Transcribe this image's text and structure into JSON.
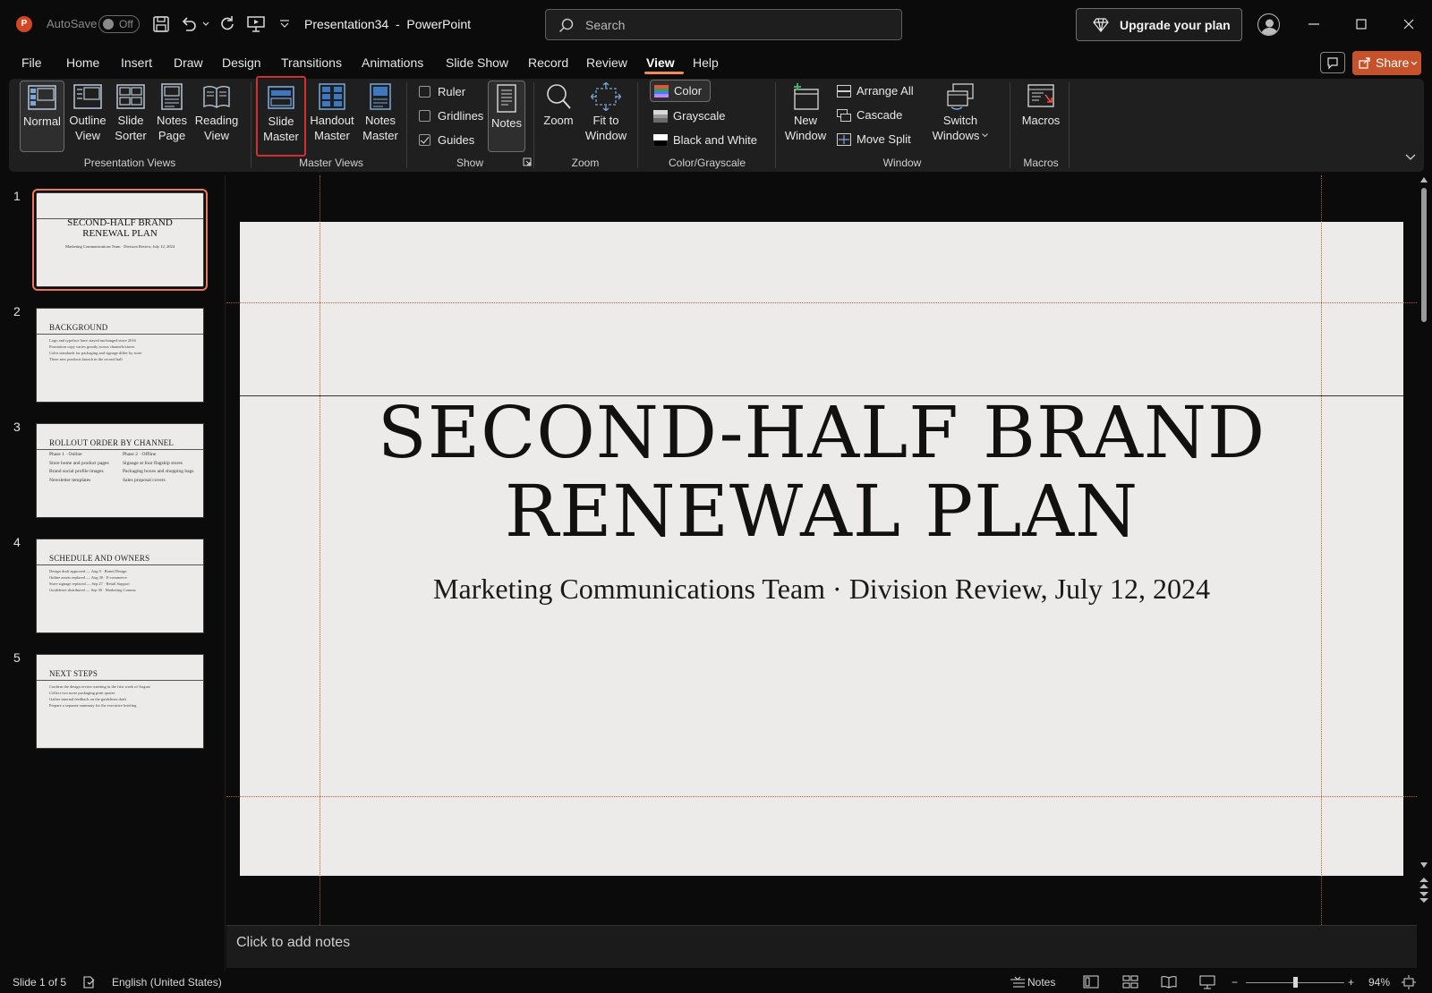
{
  "titlebar": {
    "app_logo": "P",
    "autosave_label": "AutoSave",
    "autosave_state": "Off",
    "doc_title": "Presentation34  -  PowerPoint",
    "search_placeholder": "Search",
    "upgrade_label": "Upgrade your plan"
  },
  "menu": {
    "items": [
      "File",
      "Home",
      "Insert",
      "Draw",
      "Design",
      "Transitions",
      "Animations",
      "Slide Show",
      "Record",
      "Review",
      "View",
      "Help"
    ],
    "active": "View",
    "share_label": "Share"
  },
  "ribbon": {
    "presentation_views": {
      "label": "Presentation Views",
      "normal": "Normal",
      "outline_1": "Outline",
      "outline_2": "View",
      "sorter_1": "Slide",
      "sorter_2": "Sorter",
      "notes_page_1": "Notes",
      "notes_page_2": "Page",
      "reading_1": "Reading",
      "reading_2": "View"
    },
    "master_views": {
      "label": "Master Views",
      "slide_master_1": "Slide",
      "slide_master_2": "Master",
      "handout_master_1": "Handout",
      "handout_master_2": "Master",
      "notes_master_1": "Notes",
      "notes_master_2": "Master"
    },
    "show": {
      "label": "Show",
      "ruler": "Ruler",
      "gridlines": "Gridlines",
      "guides": "Guides",
      "notes": "Notes"
    },
    "zoom": {
      "label": "Zoom",
      "zoom": "Zoom",
      "fit_1": "Fit to",
      "fit_2": "Window"
    },
    "color_grayscale": {
      "label": "Color/Grayscale",
      "color": "Color",
      "grayscale": "Grayscale",
      "bw": "Black and White"
    },
    "window": {
      "label": "Window",
      "new_1": "New",
      "new_2": "Window",
      "arrange_all": "Arrange All",
      "cascade": "Cascade",
      "move_split": "Move Split",
      "switch_1": "Switch",
      "switch_2": "Windows"
    },
    "macros": {
      "label": "Macros",
      "macros": "Macros"
    }
  },
  "thumbnails": [
    {
      "num": "1",
      "title_1": "SECOND-HALF BRAND",
      "title_2": "RENEWAL PLAN",
      "sub": "Marketing Communications Team · Division Review, July 12, 2024"
    },
    {
      "num": "2",
      "title": "BACKGROUND",
      "lines": [
        "Logo and typeface have stayed unchanged since 2016",
        "Promotion copy varies greatly across channels/stores",
        "Color standards for packaging and signage differ by store",
        "Three new products launch in the second half"
      ]
    },
    {
      "num": "3",
      "title": "ROLLOUT ORDER BY CHANNEL",
      "left": [
        "Phase 1 · Online",
        "Store home and product pages",
        "Brand social profile images",
        "Newsletter templates"
      ],
      "right": [
        "Phase 2 · Offline",
        "Signage at four flagship stores",
        "Packaging boxes and shopping bags",
        "Sales proposal covers"
      ]
    },
    {
      "num": "4",
      "title": "SCHEDULE AND OWNERS",
      "lines": [
        "Design draft approved — Aug 9 · Brand Design",
        "Online assets replaced — Aug 30 · E-commerce",
        "Store signage replaced — Sep 27 · Retail Support",
        "Guidelines distributed — Sep 30 · Marketing Comms"
      ]
    },
    {
      "num": "5",
      "title": "NEXT STEPS",
      "lines": [
        "Confirm the design review meeting in the first week of August",
        "Collect two more packaging print quotes",
        "Gather internal feedback on the guidelines draft",
        "Prepare a separate summary for the executive briefing"
      ]
    }
  ],
  "slide": {
    "title_1": "SECOND-HALF BRAND",
    "title_2": "RENEWAL PLAN",
    "subtitle": "Marketing Communications Team · Division Review, July 12, 2024"
  },
  "notes_placeholder": "Click to add notes",
  "status": {
    "slide_of": "Slide 1 of 5",
    "language": "English (United States)",
    "notes": "Notes",
    "zoom_minus": "−",
    "zoom_plus": "+",
    "zoom_level": "94%",
    "zoom_fraction": 0.5
  },
  "colors": {
    "accent": "#f08b5b",
    "share": "#c5522a",
    "highlight": "#d32f2f",
    "selected_thumb": "#e9795a"
  }
}
